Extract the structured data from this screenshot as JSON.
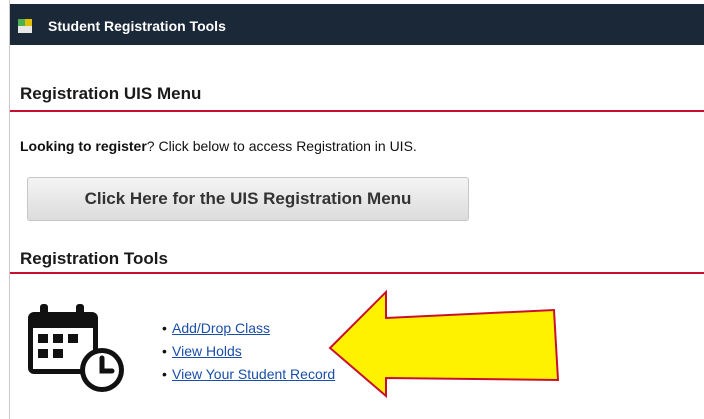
{
  "portlet": {
    "title": "Student Registration Tools"
  },
  "uis_menu": {
    "heading": "Registration UIS Menu",
    "intro_bold": "Looking to register",
    "intro_rest": "? Click below to access Registration in UIS.",
    "button_label": "Click Here for the UIS Registration Menu"
  },
  "tools": {
    "heading": "Registration Tools",
    "links": [
      {
        "label": "Add/Drop Class"
      },
      {
        "label": "View Holds"
      },
      {
        "label": "View Your Student Record"
      }
    ]
  },
  "colors": {
    "title_bar": "#1b2838",
    "rule": "#c8102e",
    "link": "#1a4ea8",
    "arrow_fill": "#fff200",
    "arrow_stroke": "#c8102e"
  },
  "icons": {
    "title": "portlet-icon",
    "tools": "calendar-clock-icon",
    "annotation": "yellow-arrow"
  }
}
